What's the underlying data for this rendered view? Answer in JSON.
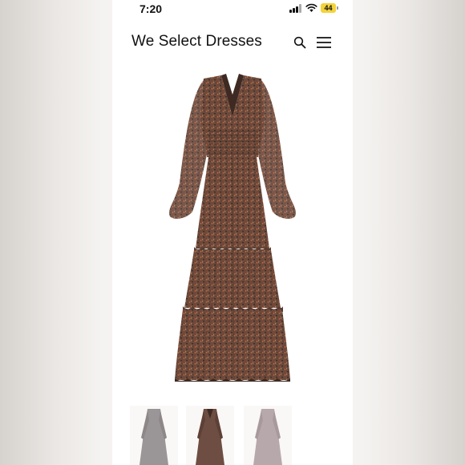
{
  "status_bar": {
    "time": "7:20",
    "battery": "44",
    "battery_color": "#f3d33b"
  },
  "header": {
    "title": "We Select Dresses",
    "search_icon": "search-icon",
    "menu_icon": "hamburger-menu-icon"
  },
  "product": {
    "main_image": "floral-long-sleeve-tiered-maxi-dress",
    "thumbnails": [
      {
        "name": "dress-thumbnail-grey"
      },
      {
        "name": "dress-thumbnail-brown"
      },
      {
        "name": "dress-thumbnail-mauve"
      }
    ]
  },
  "colors": {
    "dress_base": "#6b4a3c",
    "dress_dark": "#3e2a22",
    "thumb_grey": "#9a9596",
    "thumb_brown": "#6e4e42",
    "thumb_mauve": "#b7a9ab"
  }
}
